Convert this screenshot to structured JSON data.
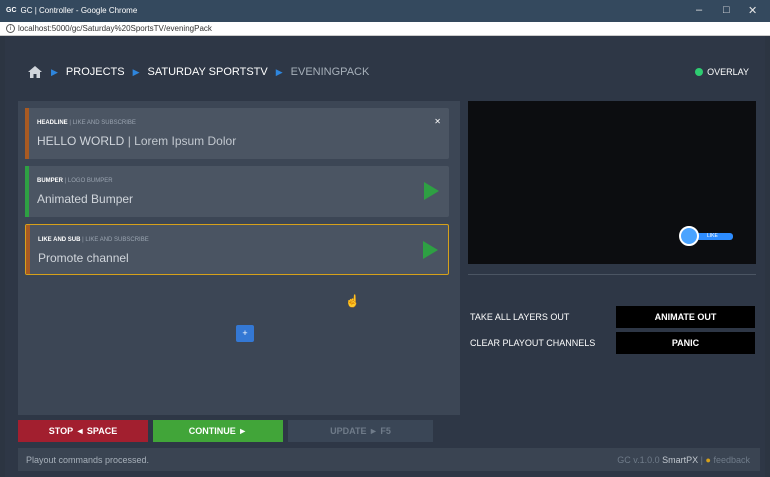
{
  "window": {
    "logo": "GC",
    "title": "GC | Controller - Google Chrome",
    "controls": [
      "–",
      "□",
      "✕"
    ]
  },
  "address_bar": {
    "url": "localhost:5000/gc/Saturday%20SportsTV/eveningPack",
    "info_icon": "info-icon"
  },
  "breadcrumb": {
    "home_icon": "home-icon",
    "items": [
      "PROJECTS",
      "SATURDAY SPORTSTV",
      "EVENINGPACK"
    ],
    "separator": "▶"
  },
  "overlay": {
    "label": "OVERLAY",
    "status_color": "#2ecc71"
  },
  "cards": [
    {
      "type": "HEADLINE",
      "template": "LIKE AND SUBSCRIBE",
      "title": "HELLO WORLD",
      "extra": "Lorem Ipsum Dolor",
      "bar_color": "#a85a22",
      "has_close": true,
      "has_play": false,
      "active": false
    },
    {
      "type": "BUMPER",
      "template": "LOGO BUMPER",
      "title": "Animated Bumper",
      "extra": "",
      "bar_color": "#2ea043",
      "has_close": false,
      "has_play": true,
      "active": false
    },
    {
      "type": "LIKE AND SUB",
      "template": "LIKE AND SUBSCRIBE",
      "title": "Promote channel",
      "extra": "",
      "bar_color": "#a85a22",
      "has_close": false,
      "has_play": true,
      "active": true
    }
  ],
  "add_button": "+",
  "preview": {
    "like_label": "LIKE"
  },
  "actions": [
    {
      "label": "TAKE ALL LAYERS OUT",
      "button": "ANIMATE OUT"
    },
    {
      "label": "CLEAR PLAYOUT CHANNELS",
      "button": "PANIC"
    }
  ],
  "buttons": {
    "stop": "STOP ◄ SPACE",
    "continue": "CONTINUE ►",
    "update": "UPDATE ► F5"
  },
  "status": {
    "message": "Playout commands processed.",
    "version_prefix": "GC v.1.0.0",
    "brand": "SmartPX",
    "feedback": "feedback"
  }
}
